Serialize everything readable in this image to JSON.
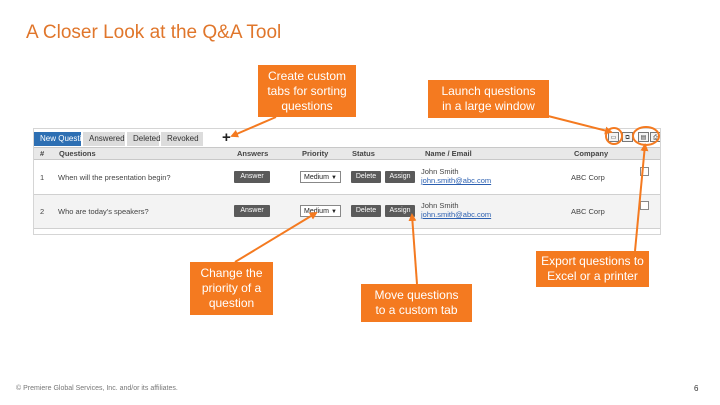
{
  "title": "A Closer Look at the Q&A Tool",
  "callouts": {
    "custom_tabs": "Create custom\ntabs for sorting\nquestions",
    "launch": "Launch questions\nin a large window",
    "priority": "Change the\npriority of a\nquestion",
    "move": "Move questions\nto a custom tab",
    "export": "Export questions to\nExcel or a printer"
  },
  "tool": {
    "tabs": [
      "New Questions",
      "Answered",
      "Deleted",
      "Revoked"
    ],
    "add_tab": "+",
    "columns": {
      "num": "#",
      "questions": "Questions",
      "answers": "Answers",
      "priority": "Priority",
      "status": "Status",
      "name_email": "Name / Email",
      "company": "Company"
    },
    "rows": [
      {
        "num": "1",
        "question": "When will the presentation begin?",
        "answer_btn": "Answer",
        "priority": "Medium",
        "delete_btn": "Delete",
        "assign_btn": "Assign",
        "name": "John Smith",
        "email": "john.smith@abc.com",
        "company": "ABC Corp"
      },
      {
        "num": "2",
        "question": "Who are today's speakers?",
        "answer_btn": "Answer",
        "priority": "Medium",
        "delete_btn": "Delete",
        "assign_btn": "Assign",
        "name": "John Smith",
        "email": "john.smith@abc.com",
        "company": "ABC Corp"
      }
    ]
  },
  "footer": "© Premiere Global Services, Inc. and/or its affiliates.",
  "page_number": "6",
  "colors": {
    "accent": "#f47a20",
    "title": "#e0762b",
    "active_tab": "#2d6fb3"
  }
}
